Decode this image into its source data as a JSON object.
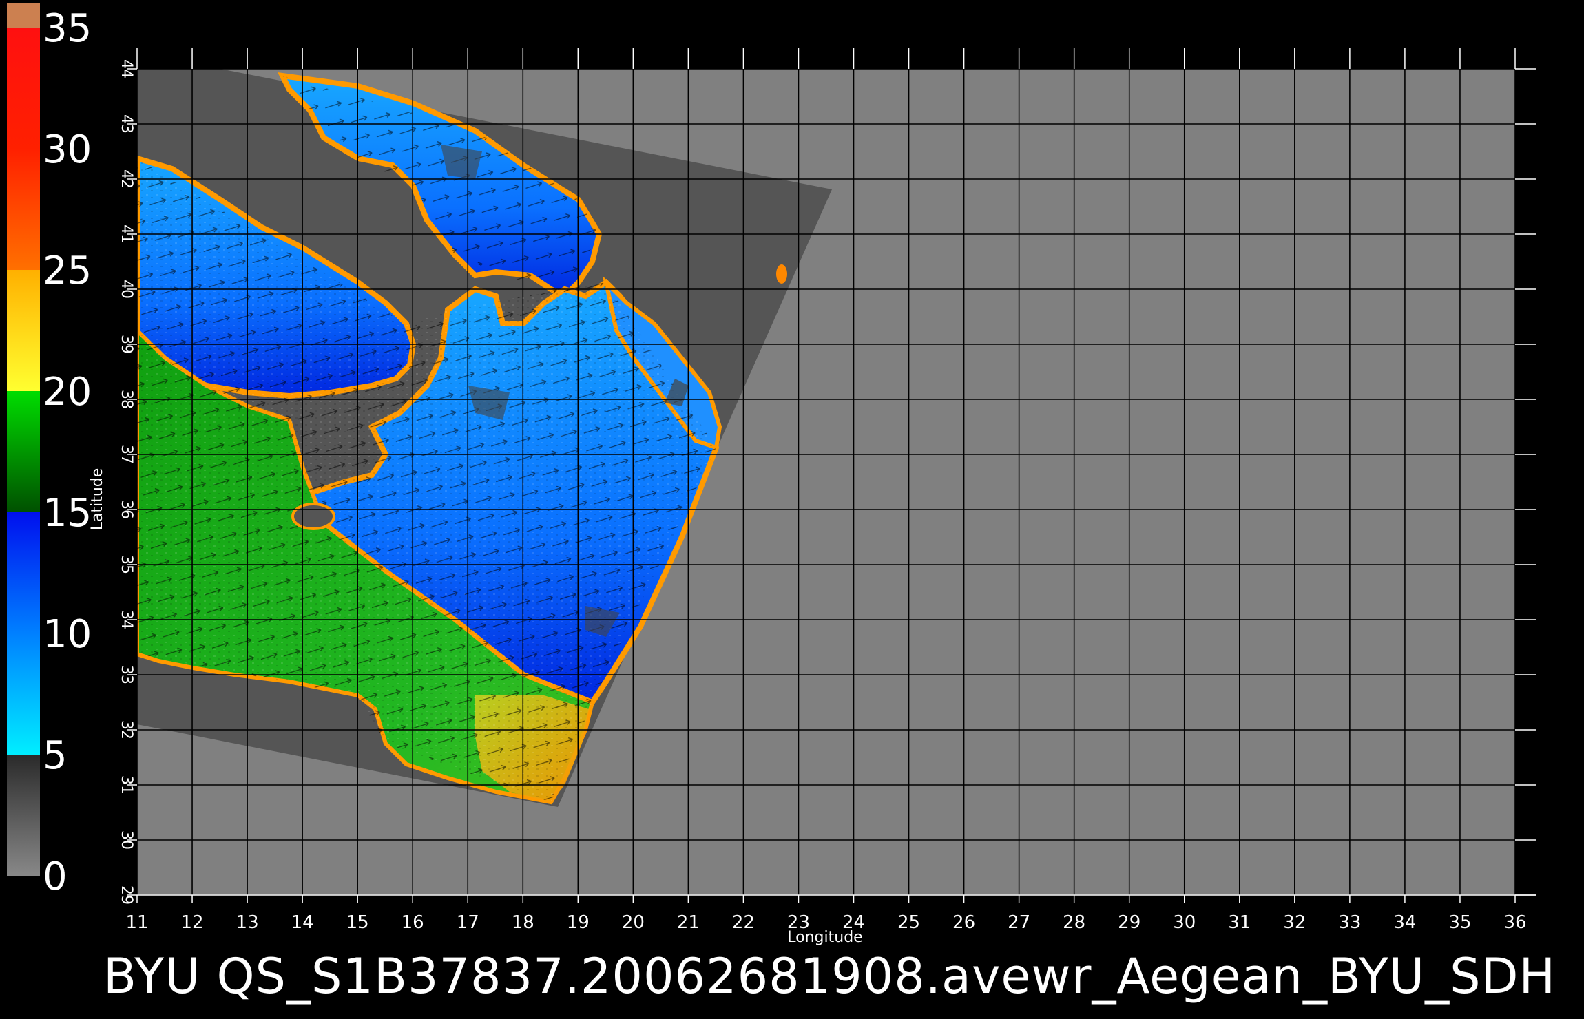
{
  "caption": "BYU  QS_S1B37837.20062681908.avewr_Aegean_BYU_SDH",
  "x_axis": {
    "label": "Longitude",
    "ticks": [
      "11",
      "12",
      "13",
      "14",
      "15",
      "16",
      "17",
      "18",
      "19",
      "20",
      "21",
      "22",
      "23",
      "24",
      "25",
      "26",
      "27",
      "28",
      "29",
      "30",
      "31",
      "32",
      "33",
      "34",
      "35",
      "36"
    ]
  },
  "y_axis": {
    "label": "Latitude",
    "ticks": [
      "29",
      "30",
      "31",
      "32",
      "33",
      "34",
      "35",
      "36",
      "37",
      "38",
      "39",
      "40",
      "41",
      "42",
      "43",
      "44"
    ]
  },
  "colorbar": {
    "labels": [
      "0",
      "5",
      "10",
      "15",
      "20",
      "25",
      "30",
      "35"
    ],
    "stops": [
      {
        "from": 0,
        "to": 5,
        "colors": [
          "#888888",
          "#2a2a2a"
        ]
      },
      {
        "from": 5,
        "to": 10,
        "colors": [
          "#00eeff",
          "#0080ff"
        ]
      },
      {
        "from": 10,
        "to": 15,
        "colors": [
          "#0080ff",
          "#0010ee"
        ]
      },
      {
        "from": 15,
        "to": 20,
        "colors": [
          "#005000",
          "#00dd00"
        ]
      },
      {
        "from": 20,
        "to": 25,
        "colors": [
          "#ffff30",
          "#ffb000"
        ]
      },
      {
        "from": 25,
        "to": 30,
        "colors": [
          "#ff7000",
          "#ff2000"
        ]
      },
      {
        "from": 30,
        "to": 35,
        "colors": [
          "#ff2000",
          "#ff1010"
        ]
      },
      {
        "from": 35,
        "to": 36,
        "colors": [
          "#cc8050",
          "#cc8050"
        ]
      }
    ]
  },
  "colors": {
    "background": "#000000",
    "map_fill": "#808080",
    "swath_land": "#555555",
    "grid": "#000000",
    "text": "#ffffff"
  }
}
